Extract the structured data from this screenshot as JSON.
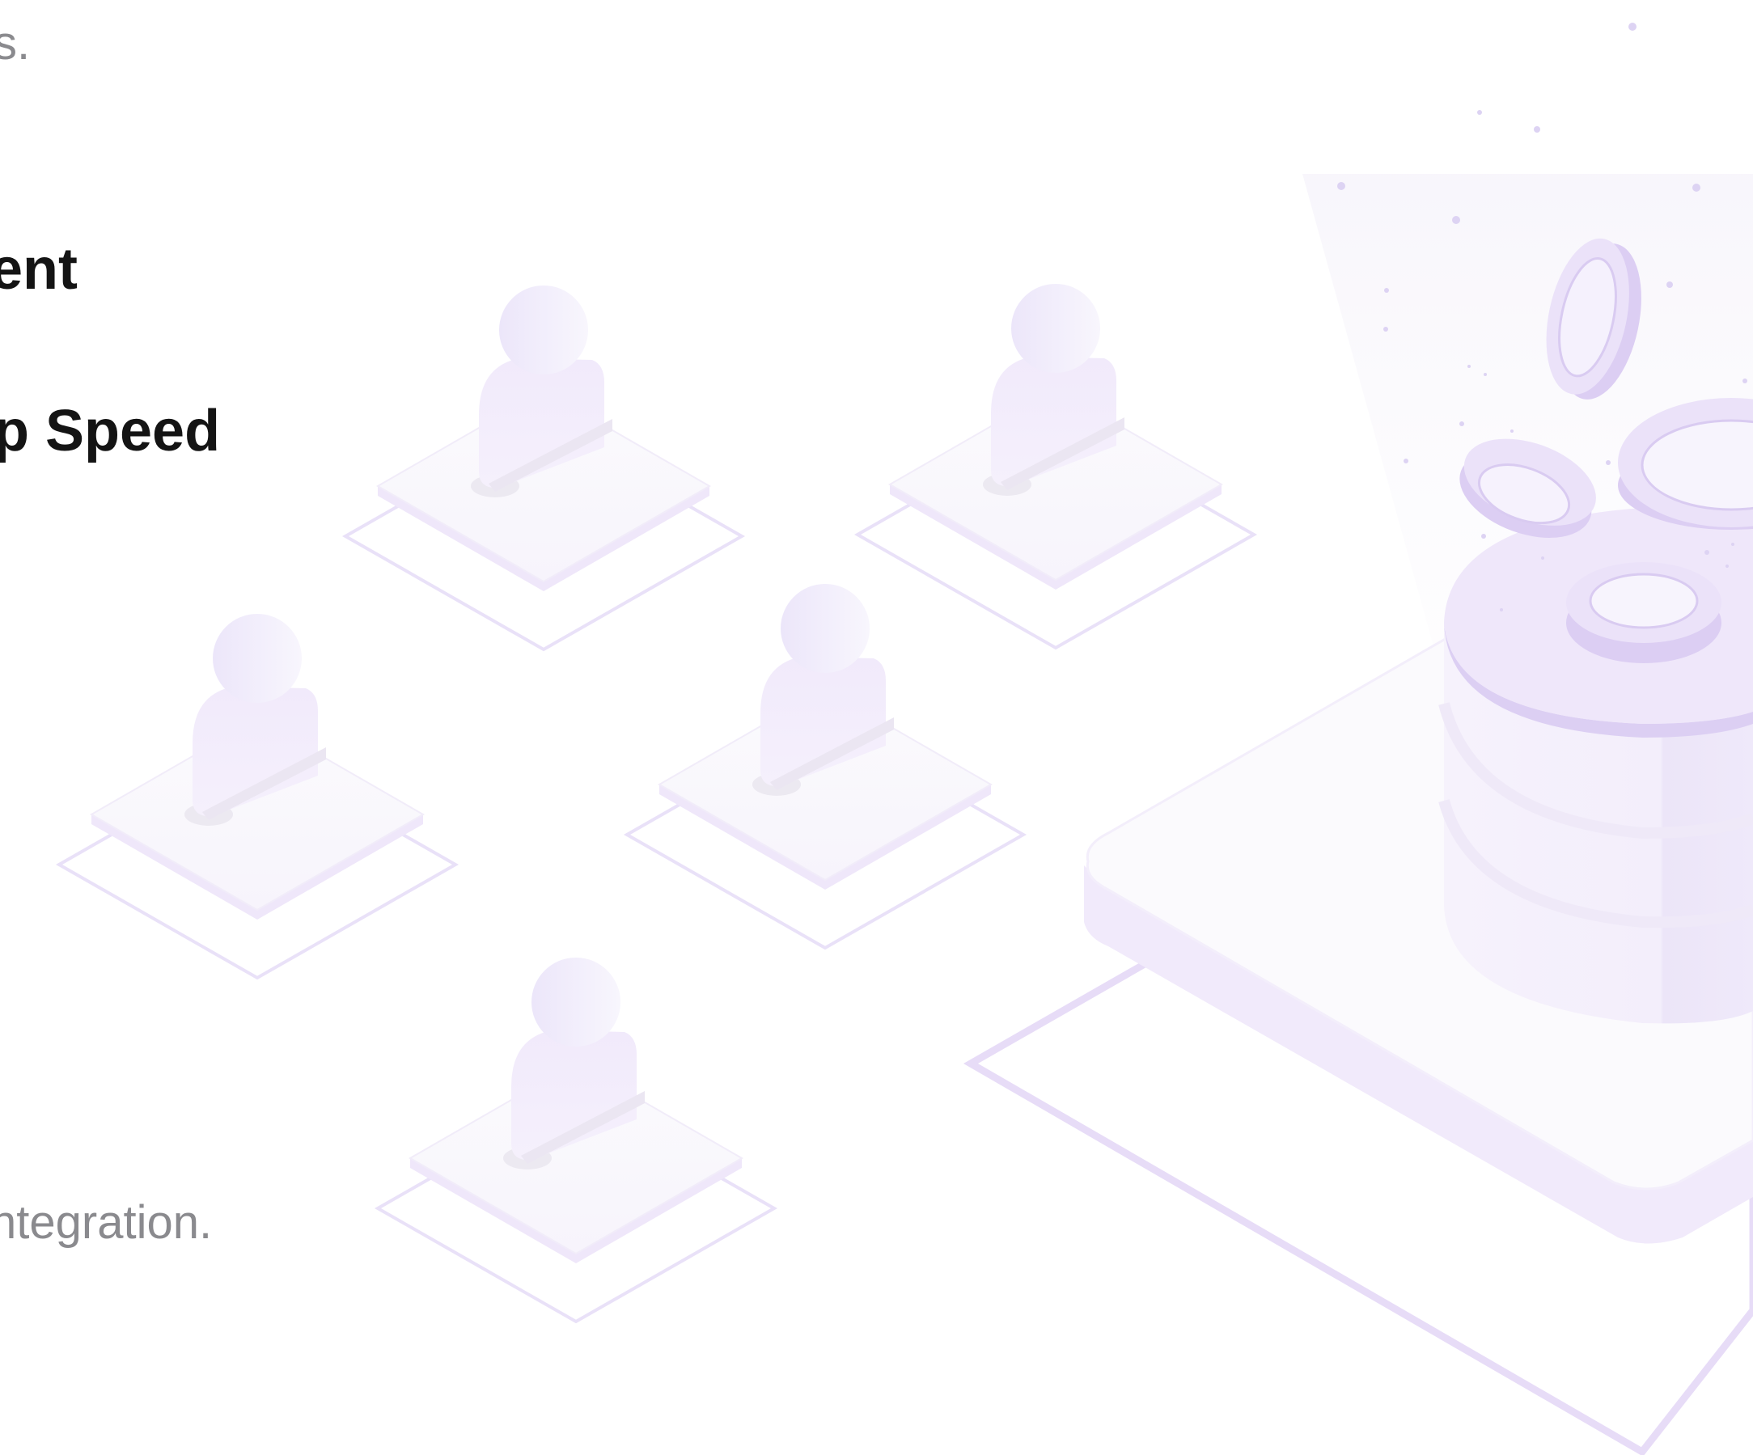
{
  "text": {
    "top_fragment": "s.",
    "heading_1_fragment": "ent",
    "heading_2_fragment": "p Speed",
    "bottom_fragment": "ntegration."
  },
  "illustration": {
    "user_platform_icon": "user-on-platform-icon",
    "database_icon": "database-with-coins-icon",
    "user_count": 5,
    "accent_color": "#e7dcf7",
    "accent_dark": "#d8c8f2",
    "outline_color": "#e6dcf6"
  }
}
